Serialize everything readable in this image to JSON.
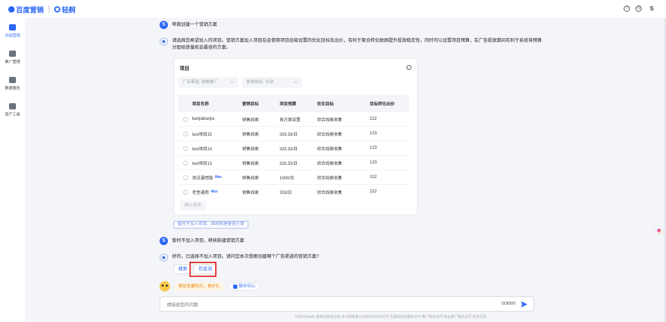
{
  "header": {
    "brand_baidu": "百度营销",
    "brand_qing": "轻舸",
    "avatar_letter": "S"
  },
  "sidebar": {
    "items": [
      {
        "label": "对话营销",
        "icon": "chat-icon",
        "active": true
      },
      {
        "label": "推广管理",
        "icon": "monitor-icon",
        "active": false
      },
      {
        "label": "数据报告",
        "icon": "report-icon",
        "active": false
      },
      {
        "label": "资产工具",
        "icon": "toolbox-icon",
        "active": false
      }
    ]
  },
  "chat": {
    "user_avatar": "S",
    "user_msg1": "帮我创建一个营销方案",
    "ai_msg1_line1": "请选择您希望加入的项目。营销方案加入项目后会使用项目层级设置的优化目标及出价，有利于聚合转化数据提升投放稳定性，同时可以设置项目预算，在广告投放期间有利于系统将预算",
    "ai_msg1_line2": "分配给获量机会最佳的方案。",
    "project_card": {
      "title": "项目",
      "filter_channel": "广告渠道: 搜索推广",
      "filter_goal": "营销目标: 全部",
      "columns": [
        "项目名称",
        "营销目标",
        "项目预算",
        "优化目标",
        "目标转化出价"
      ],
      "rows": [
        {
          "name": "banjiabanjia",
          "tag": "",
          "goal": "销售线索",
          "budget": "按方案设置",
          "opt": "综合线索收集",
          "bid": "222"
        },
        {
          "name": "test项目15",
          "tag": "",
          "goal": "销售线索",
          "budget": "333.33/日",
          "opt": "综合线索收集",
          "bid": "123"
        },
        {
          "name": "test项目14",
          "tag": "",
          "goal": "销售线索",
          "budget": "333.33/日",
          "opt": "综合线索收集",
          "bid": "123"
        },
        {
          "name": "test项目13",
          "tag": "",
          "goal": "销售线索",
          "budget": "333.33/日",
          "opt": "综合线索收集",
          "bid": "123"
        },
        {
          "name": "测试通用版",
          "tag": "Max",
          "goal": "销售线索",
          "budget": "1000/日",
          "opt": "综合线索收集",
          "bid": "222"
        },
        {
          "name": "老性通用",
          "tag": "Max",
          "goal": "销售线索",
          "budget": "333/日",
          "opt": "综合线索收集",
          "bid": "222"
        }
      ],
      "confirm_label": "确认使用"
    },
    "skip_link": "暂时不加入项目，继续新建营销方案",
    "user_msg2": "暂时不加入项目，继续新建营销方案",
    "ai_msg2": "好的，已选择不加入项目。请问您本次想要创建哪个广告渠道的营销方案?",
    "choice_search": "搜索",
    "choice_feed": "信息流",
    "task_pill": "做任务赢阳光，换好礼",
    "cmd_pill": "指令中心",
    "input_placeholder": "请描述您的问题",
    "counter": "0/3000",
    "footer": "©2024 Baidu 使用百度前必读 京公网安备11000002000001号 互联网信息服务许可 推广服务合同 商业推广服务合同 意见反馈"
  },
  "colors": {
    "accent": "#2b67f6",
    "highlight": "#e53935"
  }
}
